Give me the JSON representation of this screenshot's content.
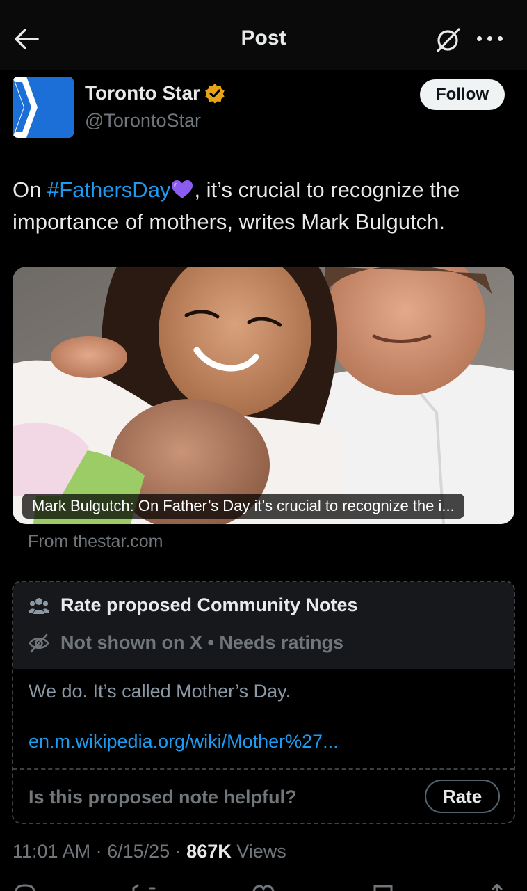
{
  "header": {
    "title": "Post",
    "icons": [
      "back-arrow-icon",
      "grok-icon",
      "more-icon"
    ]
  },
  "author": {
    "name": "Toronto Star",
    "handle": "@TorontoStar",
    "verified_color": "#e8a317",
    "follow_label": "Follow"
  },
  "tweet": {
    "text_prefix": "On ",
    "hashtag": "#FathersDay",
    "emoji": "purple-heart",
    "text_suffix": ", it’s crucial to recognize the importance of mothers, writes Mark Bulgutch."
  },
  "card": {
    "caption": "Mark Bulgutch: On Father’s Day it’s crucial to recognize the i...",
    "source": "From thestar.com"
  },
  "community_notes": {
    "title": "Rate proposed Community Notes",
    "status": "Not shown on X • Needs ratings",
    "note_text": "We do.  It’s called Mother’s Day.",
    "note_link": "en.m.wikipedia.org/wiki/Mother%27...",
    "question": "Is this proposed note helpful?",
    "rate_label": "Rate"
  },
  "meta": {
    "time": "11:01 AM",
    "date": "6/15/25",
    "views_count": "867K",
    "views_label": "Views"
  },
  "colors": {
    "accent": "#1d9bf0",
    "background": "#000000",
    "muted": "#71767b",
    "heart": "#8c5cf0"
  }
}
